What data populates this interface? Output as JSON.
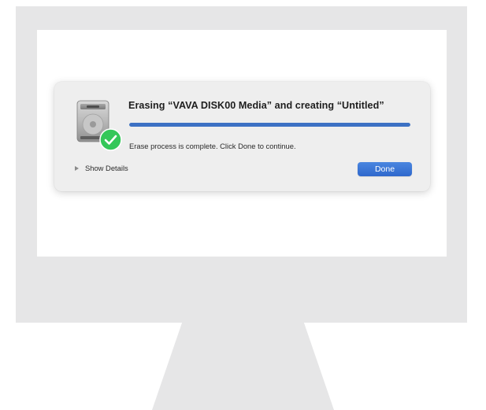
{
  "dialog": {
    "title": "Erasing “VAVA DISK00 Media” and creating “Untitled”",
    "progress": 1.0,
    "status": "Erase process is complete. Click Done to continue.",
    "show_details_label": "Show Details",
    "done_label": "Done",
    "icon": "hard-disk-icon",
    "badge_icon": "checkmark-icon"
  },
  "colors": {
    "accent": "#3c71c4",
    "success": "#34c759"
  }
}
